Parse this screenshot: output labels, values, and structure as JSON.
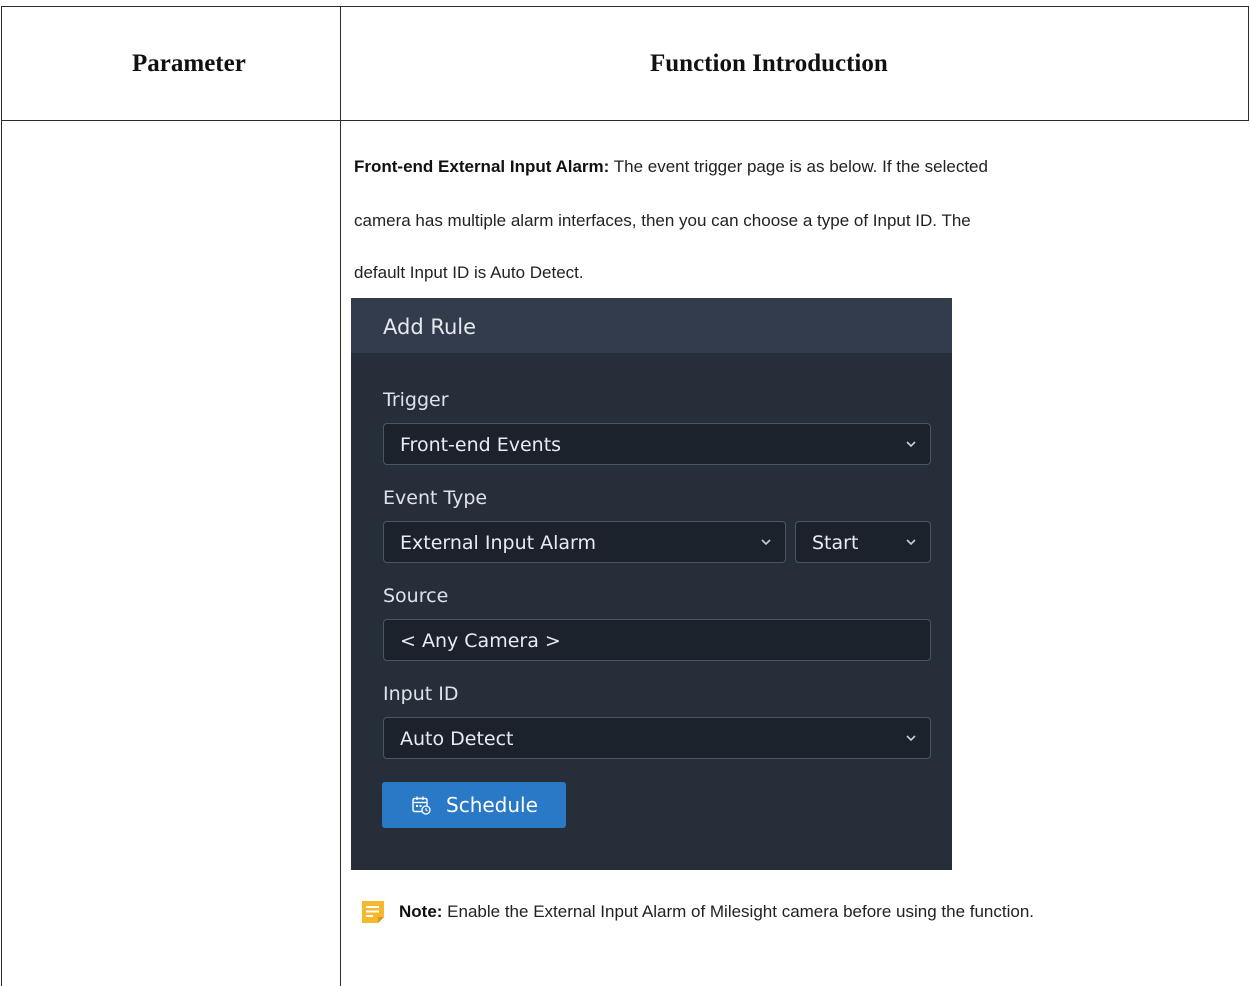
{
  "table": {
    "header_parameter": "Parameter",
    "header_function": "Function Introduction"
  },
  "description": {
    "lead": "Front-end External Input Alarm:",
    "line1": " The event trigger page is as below. If the selected",
    "line2": "camera has multiple alarm interfaces, then you can choose a type of Input ID. The",
    "line3": "default Input ID is Auto Detect."
  },
  "dialog": {
    "title": "Add Rule",
    "trigger_label": "Trigger",
    "trigger_value": "Front-end Events",
    "event_type_label": "Event Type",
    "event_type_value": "External Input Alarm",
    "event_state_value": "Start",
    "source_label": "Source",
    "source_value": "< Any Camera >",
    "input_id_label": "Input ID",
    "input_id_value": "Auto Detect",
    "schedule_button": "Schedule",
    "icons": [
      "chevron-down-icon",
      "calendar-icon"
    ],
    "colors": {
      "panel": "#262e3a",
      "header": "#323c4c",
      "field": "#1b222c",
      "button": "#2a79c6"
    }
  },
  "note": {
    "lead": "Note:",
    "text": "  Enable the External Input Alarm of Milesight camera before using the function.",
    "icon": "note-icon",
    "icon_color": "#f5b82e"
  }
}
